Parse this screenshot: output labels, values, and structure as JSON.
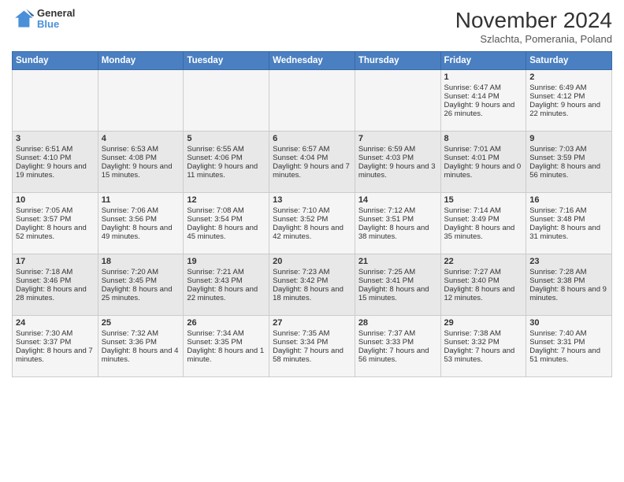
{
  "logo": {
    "line1": "General",
    "line2": "Blue"
  },
  "title": "November 2024",
  "location": "Szlachta, Pomerania, Poland",
  "days_of_week": [
    "Sunday",
    "Monday",
    "Tuesday",
    "Wednesday",
    "Thursday",
    "Friday",
    "Saturday"
  ],
  "weeks": [
    [
      {
        "day": "",
        "info": ""
      },
      {
        "day": "",
        "info": ""
      },
      {
        "day": "",
        "info": ""
      },
      {
        "day": "",
        "info": ""
      },
      {
        "day": "",
        "info": ""
      },
      {
        "day": "1",
        "info": "Sunrise: 6:47 AM\nSunset: 4:14 PM\nDaylight: 9 hours and 26 minutes."
      },
      {
        "day": "2",
        "info": "Sunrise: 6:49 AM\nSunset: 4:12 PM\nDaylight: 9 hours and 22 minutes."
      }
    ],
    [
      {
        "day": "3",
        "info": "Sunrise: 6:51 AM\nSunset: 4:10 PM\nDaylight: 9 hours and 19 minutes."
      },
      {
        "day": "4",
        "info": "Sunrise: 6:53 AM\nSunset: 4:08 PM\nDaylight: 9 hours and 15 minutes."
      },
      {
        "day": "5",
        "info": "Sunrise: 6:55 AM\nSunset: 4:06 PM\nDaylight: 9 hours and 11 minutes."
      },
      {
        "day": "6",
        "info": "Sunrise: 6:57 AM\nSunset: 4:04 PM\nDaylight: 9 hours and 7 minutes."
      },
      {
        "day": "7",
        "info": "Sunrise: 6:59 AM\nSunset: 4:03 PM\nDaylight: 9 hours and 3 minutes."
      },
      {
        "day": "8",
        "info": "Sunrise: 7:01 AM\nSunset: 4:01 PM\nDaylight: 9 hours and 0 minutes."
      },
      {
        "day": "9",
        "info": "Sunrise: 7:03 AM\nSunset: 3:59 PM\nDaylight: 8 hours and 56 minutes."
      }
    ],
    [
      {
        "day": "10",
        "info": "Sunrise: 7:05 AM\nSunset: 3:57 PM\nDaylight: 8 hours and 52 minutes."
      },
      {
        "day": "11",
        "info": "Sunrise: 7:06 AM\nSunset: 3:56 PM\nDaylight: 8 hours and 49 minutes."
      },
      {
        "day": "12",
        "info": "Sunrise: 7:08 AM\nSunset: 3:54 PM\nDaylight: 8 hours and 45 minutes."
      },
      {
        "day": "13",
        "info": "Sunrise: 7:10 AM\nSunset: 3:52 PM\nDaylight: 8 hours and 42 minutes."
      },
      {
        "day": "14",
        "info": "Sunrise: 7:12 AM\nSunset: 3:51 PM\nDaylight: 8 hours and 38 minutes."
      },
      {
        "day": "15",
        "info": "Sunrise: 7:14 AM\nSunset: 3:49 PM\nDaylight: 8 hours and 35 minutes."
      },
      {
        "day": "16",
        "info": "Sunrise: 7:16 AM\nSunset: 3:48 PM\nDaylight: 8 hours and 31 minutes."
      }
    ],
    [
      {
        "day": "17",
        "info": "Sunrise: 7:18 AM\nSunset: 3:46 PM\nDaylight: 8 hours and 28 minutes."
      },
      {
        "day": "18",
        "info": "Sunrise: 7:20 AM\nSunset: 3:45 PM\nDaylight: 8 hours and 25 minutes."
      },
      {
        "day": "19",
        "info": "Sunrise: 7:21 AM\nSunset: 3:43 PM\nDaylight: 8 hours and 22 minutes."
      },
      {
        "day": "20",
        "info": "Sunrise: 7:23 AM\nSunset: 3:42 PM\nDaylight: 8 hours and 18 minutes."
      },
      {
        "day": "21",
        "info": "Sunrise: 7:25 AM\nSunset: 3:41 PM\nDaylight: 8 hours and 15 minutes."
      },
      {
        "day": "22",
        "info": "Sunrise: 7:27 AM\nSunset: 3:40 PM\nDaylight: 8 hours and 12 minutes."
      },
      {
        "day": "23",
        "info": "Sunrise: 7:28 AM\nSunset: 3:38 PM\nDaylight: 8 hours and 9 minutes."
      }
    ],
    [
      {
        "day": "24",
        "info": "Sunrise: 7:30 AM\nSunset: 3:37 PM\nDaylight: 8 hours and 7 minutes."
      },
      {
        "day": "25",
        "info": "Sunrise: 7:32 AM\nSunset: 3:36 PM\nDaylight: 8 hours and 4 minutes."
      },
      {
        "day": "26",
        "info": "Sunrise: 7:34 AM\nSunset: 3:35 PM\nDaylight: 8 hours and 1 minute."
      },
      {
        "day": "27",
        "info": "Sunrise: 7:35 AM\nSunset: 3:34 PM\nDaylight: 7 hours and 58 minutes."
      },
      {
        "day": "28",
        "info": "Sunrise: 7:37 AM\nSunset: 3:33 PM\nDaylight: 7 hours and 56 minutes."
      },
      {
        "day": "29",
        "info": "Sunrise: 7:38 AM\nSunset: 3:32 PM\nDaylight: 7 hours and 53 minutes."
      },
      {
        "day": "30",
        "info": "Sunrise: 7:40 AM\nSunset: 3:31 PM\nDaylight: 7 hours and 51 minutes."
      }
    ]
  ]
}
